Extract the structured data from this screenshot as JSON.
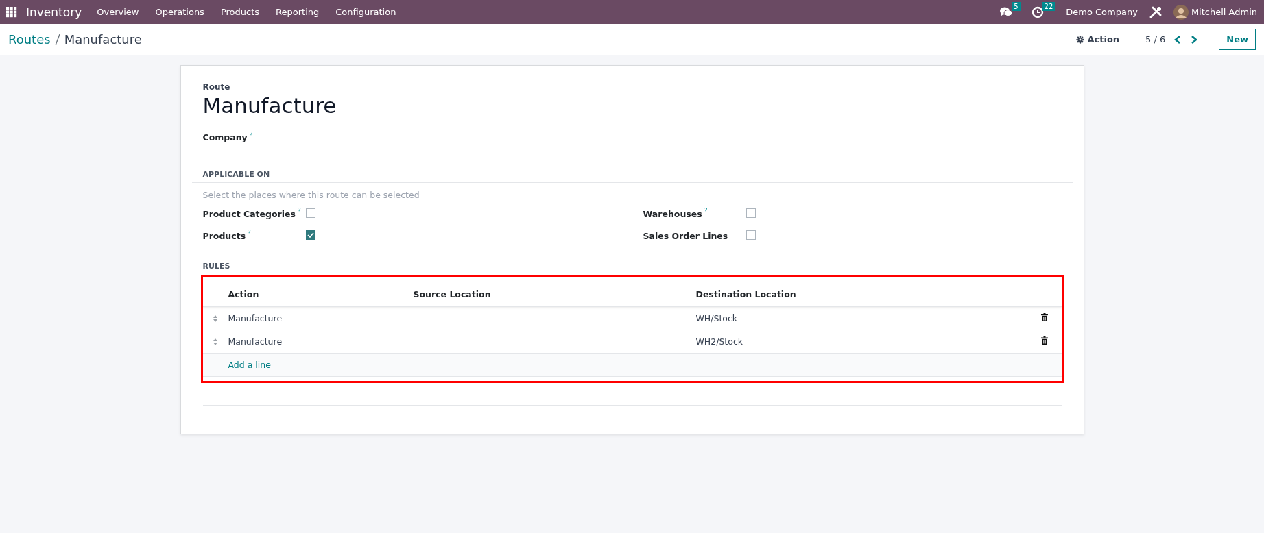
{
  "navbar": {
    "app": "Inventory",
    "menu": [
      "Overview",
      "Operations",
      "Products",
      "Reporting",
      "Configuration"
    ],
    "messages_count": "5",
    "activities_count": "22",
    "company": "Demo Company",
    "user": "Mitchell Admin"
  },
  "control_bar": {
    "breadcrumb_parent": "Routes",
    "breadcrumb_current": "Manufacture",
    "action": "Action",
    "pager": "5 / 6",
    "new_button": "New"
  },
  "form": {
    "title_label": "Route",
    "title": "Manufacture",
    "company_label": "Company",
    "help_mark": "?",
    "applicable_heading": "APPLICABLE ON",
    "applicable_hint": "Select the places where this route can be selected",
    "applicable": [
      {
        "label": "Product Categories",
        "help": true,
        "checked": false
      },
      {
        "label": "Warehouses",
        "help": true,
        "checked": false
      },
      {
        "label": "Products",
        "help": true,
        "checked": true
      },
      {
        "label": "Sales Order Lines",
        "help": false,
        "checked": false
      }
    ],
    "rules_heading": "RULES",
    "highlighted": true,
    "rules": {
      "columns": [
        "Action",
        "Source Location",
        "Destination Location"
      ],
      "rows": [
        {
          "action": "Manufacture",
          "source": "",
          "destination": "WH/Stock"
        },
        {
          "action": "Manufacture",
          "source": "",
          "destination": "WH2/Stock"
        }
      ],
      "add_line": "Add a line"
    }
  }
}
